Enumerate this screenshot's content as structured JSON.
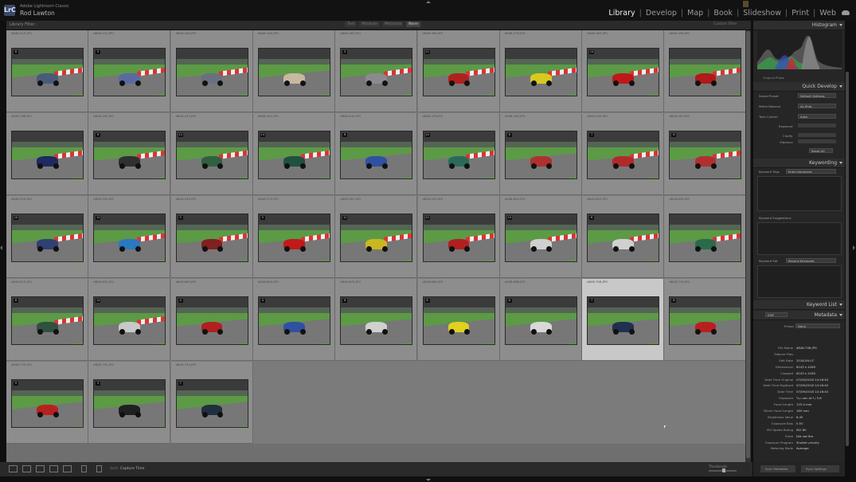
{
  "app": {
    "name": "Adobe Lightroom Classic",
    "user": "Rod Lawton",
    "logo": "LrC",
    "modules": [
      {
        "label": "Library",
        "active": true
      },
      {
        "label": "Develop",
        "active": false
      },
      {
        "label": "Map",
        "active": false
      },
      {
        "label": "Book",
        "active": false
      },
      {
        "label": "Slideshow",
        "active": false
      },
      {
        "label": "Print",
        "active": false
      },
      {
        "label": "Web",
        "active": false
      }
    ],
    "cloud_icon": "cloud-icon"
  },
  "filter_bar": {
    "title": "Library Filter :",
    "tabs": [
      {
        "label": "Text",
        "active": false
      },
      {
        "label": "Attribute",
        "active": false
      },
      {
        "label": "Metadata",
        "active": false
      },
      {
        "label": "None",
        "active": true
      }
    ],
    "preset": "Custom Filter"
  },
  "grid": {
    "cells": [
      {
        "file": "d848-319.JPG",
        "badge": "6",
        "car_color": "#4a5a7a",
        "kerb": true,
        "selected": false
      },
      {
        "file": "d848-321.JPG",
        "badge": "5",
        "car_color": "#5a6aa0",
        "kerb": true,
        "selected": false
      },
      {
        "file": "d848-340.JPG",
        "badge": "",
        "car_color": "#6a7080",
        "kerb": true,
        "selected": false
      },
      {
        "file": "d848-345.JPG",
        "badge": "",
        "car_color": "#c8b8a0",
        "kerb": false,
        "selected": false
      },
      {
        "file": "d848-363.JPG",
        "badge": "5",
        "car_color": "#8a8a90",
        "kerb": true,
        "selected": false
      },
      {
        "file": "d848-365.JPG",
        "badge": "12",
        "car_color": "#b02020",
        "kerb": true,
        "selected": false
      },
      {
        "file": "d848-375.JPG",
        "badge": "",
        "car_color": "#d8c820",
        "kerb": true,
        "selected": false
      },
      {
        "file": "d848-382.JPG",
        "badge": "14",
        "car_color": "#c01818",
        "kerb": true,
        "selected": false
      },
      {
        "file": "d848-396.JPG",
        "badge": "",
        "car_color": "#b01a1a",
        "kerb": true,
        "selected": false
      },
      {
        "file": "d848-398.JPG",
        "badge": "",
        "car_color": "#1e2a60",
        "kerb": true,
        "selected": false
      },
      {
        "file": "d848-402.JPG",
        "badge": "6",
        "car_color": "#303030",
        "kerb": true,
        "selected": false
      },
      {
        "file": "d848-433.JPG",
        "badge": "14",
        "car_color": "#306040",
        "kerb": true,
        "selected": false
      },
      {
        "file": "d848-441.JPG",
        "badge": "14",
        "car_color": "#205040",
        "kerb": true,
        "selected": false
      },
      {
        "file": "d848-444.JPG",
        "badge": "6",
        "car_color": "#3050a0",
        "kerb": false,
        "selected": false
      },
      {
        "file": "d848-476.JPG",
        "badge": "14",
        "car_color": "#2a6a5a",
        "kerb": true,
        "selected": false
      },
      {
        "file": "d848-492.JPG",
        "badge": "6",
        "car_color": "#b03030",
        "kerb": false,
        "selected": false
      },
      {
        "file": "d848-499.JPG",
        "badge": "7",
        "car_color": "#b02a2a",
        "kerb": true,
        "selected": false
      },
      {
        "file": "d848-503.JPG",
        "badge": "8",
        "car_color": "#b03030",
        "kerb": true,
        "selected": false
      },
      {
        "file": "d848-509.JPG",
        "badge": "10",
        "car_color": "#304070",
        "kerb": true,
        "selected": false
      },
      {
        "file": "d848-530.JPG",
        "badge": "12",
        "car_color": "#2a78c0",
        "kerb": true,
        "selected": false
      },
      {
        "file": "d848-549.JPG",
        "badge": "5",
        "car_color": "#802020",
        "kerb": true,
        "selected": false
      },
      {
        "file": "d848-572.JPG",
        "badge": "5",
        "car_color": "#c01a1a",
        "kerb": true,
        "selected": false
      },
      {
        "file": "d848-581.JPG",
        "badge": "12",
        "car_color": "#c8b820",
        "kerb": true,
        "selected": false
      },
      {
        "file": "d848-591.JPG",
        "badge": "10",
        "car_color": "#b02020",
        "kerb": true,
        "selected": false
      },
      {
        "file": "d848-600.JPG",
        "badge": "10",
        "car_color": "#d0d0d0",
        "kerb": true,
        "selected": false
      },
      {
        "file": "d848-602.JPG",
        "badge": "8",
        "car_color": "#d0d0d0",
        "kerb": true,
        "selected": false
      },
      {
        "file": "d848-608.JPG",
        "badge": "",
        "car_color": "#2a6a4a",
        "kerb": true,
        "selected": false
      },
      {
        "file": "d848-615.JPG",
        "badge": "6",
        "car_color": "#305040",
        "kerb": true,
        "selected": false
      },
      {
        "file": "d848-620.JPG",
        "badge": "14",
        "car_color": "#c8c8c8",
        "kerb": true,
        "selected": false
      },
      {
        "file": "d848-663.JPG",
        "badge": "4",
        "car_color": "#b02020",
        "kerb": false,
        "selected": false
      },
      {
        "file": "d848-664.JPG",
        "badge": "4",
        "car_color": "#3050a0",
        "kerb": false,
        "selected": false
      },
      {
        "file": "d848-670.JPG",
        "badge": "6",
        "car_color": "#d0d0d0",
        "kerb": false,
        "selected": false
      },
      {
        "file": "d848-680.JPG",
        "badge": "6",
        "car_color": "#e0d020",
        "kerb": false,
        "selected": false
      },
      {
        "file": "d848-688.JPG",
        "badge": "6",
        "car_color": "#d8d8d8",
        "kerb": false,
        "selected": false
      },
      {
        "file": "d848-706.JPG",
        "badge": "7",
        "car_color": "#203050",
        "kerb": false,
        "selected": true
      },
      {
        "file": "d848-716.JPG",
        "badge": "8",
        "car_color": "#b82020",
        "kerb": false,
        "selected": false
      },
      {
        "file": "d848-725.JPG",
        "badge": "9",
        "car_color": "#b82020",
        "kerb": false,
        "selected": false
      },
      {
        "file": "d848-730.JPG",
        "badge": "5",
        "car_color": "#202020",
        "kerb": false,
        "selected": false
      },
      {
        "file": "d848-743.JPG",
        "badge": "7",
        "car_color": "#203040",
        "kerb": false,
        "selected": false
      }
    ]
  },
  "toolbar": {
    "sort_label": "Sort:",
    "sort_value": "Capture Time",
    "thumbnails_label": "Thumbnails"
  },
  "panels": {
    "histogram": {
      "title": "Histogram",
      "original_photo": "Original Photo"
    },
    "quick_develop": {
      "title": "Quick Develop",
      "saved_preset_label": "Saved Preset",
      "saved_preset_value": "Default Settings",
      "white_balance_label": "White Balance",
      "white_balance_value": "As Shot",
      "tone_control_label": "Tone Control",
      "tone_control_value": "Auto",
      "exposure_label": "Exposure",
      "clarity_label": "Clarity",
      "vibrance_label": "Vibrance",
      "reset_label": "Reset All"
    },
    "keywording": {
      "title": "Keywording",
      "tags_label": "Keyword Tags",
      "tags_value": "Enter Keywords",
      "suggestions_label": "Keyword Suggestions",
      "set_label": "Keyword Set",
      "set_value": "Recent Keywords"
    },
    "keyword_list": {
      "title": "Keyword List"
    },
    "metadata": {
      "title": "Metadata",
      "mode": "EXIF",
      "preset_label": "Preset",
      "preset_value": "None",
      "fields": [
        {
          "label": "File Name",
          "value": "d848-706.JPG"
        },
        {
          "label": "Sidecar Files",
          "value": ""
        },
        {
          "label": "Edit Date",
          "value": "2018-09-07"
        },
        {
          "label": "Dimensions",
          "value": "6243 x 4160"
        },
        {
          "label": "Cropped",
          "value": "6243 x 4160"
        },
        {
          "label": "Date Time Original",
          "value": "07/09/2018 14:16:40"
        },
        {
          "label": "Date Time Digitized",
          "value": "07/09/2018 14:16:40"
        },
        {
          "label": "Date Time",
          "value": "07/09/2018 14:16:40"
        },
        {
          "label": "Exposure",
          "value": "¹⁄₁₀₀ sec at f / 5.6"
        },
        {
          "label": "Focal Length",
          "value": "125.0 mm"
        },
        {
          "label": "35mm Focal Length",
          "value": "185 mm"
        },
        {
          "label": "Brightness Value",
          "value": "8.45"
        },
        {
          "label": "Exposure Bias",
          "value": "0 EV"
        },
        {
          "label": "ISO Speed Rating",
          "value": "ISO 80"
        },
        {
          "label": "Flash",
          "value": "Did not fire"
        },
        {
          "label": "Exposure Program",
          "value": "Shutter priority"
        },
        {
          "label": "Metering Mode",
          "value": "Average"
        }
      ]
    },
    "sync_metadata": "Sync Metadata",
    "sync_settings": "Sync Settings"
  }
}
